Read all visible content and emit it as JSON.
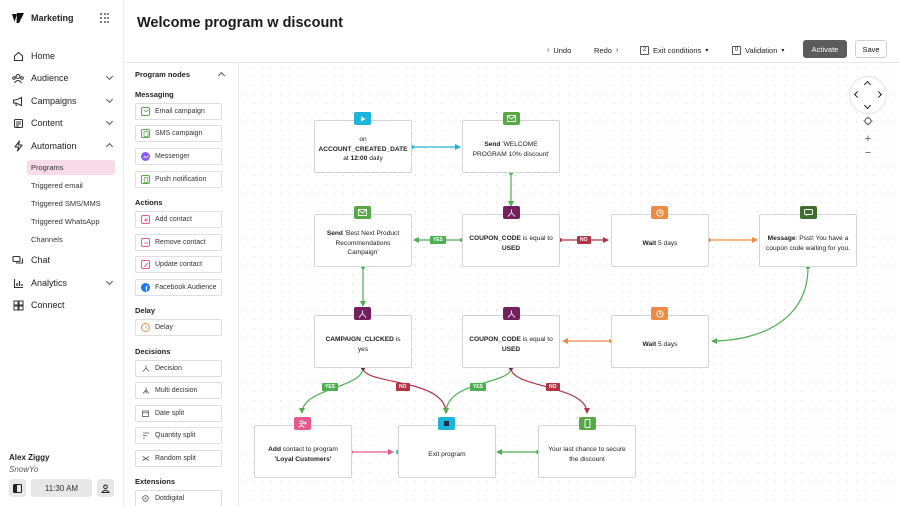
{
  "app": {
    "name": "Marketing"
  },
  "nav": {
    "items": [
      {
        "label": "Home",
        "icon": "home-icon"
      },
      {
        "label": "Audience",
        "icon": "audience-icon"
      },
      {
        "label": "Campaigns",
        "icon": "megaphone-icon"
      },
      {
        "label": "Content",
        "icon": "content-icon"
      },
      {
        "label": "Automation",
        "icon": "automation-icon"
      }
    ],
    "automation_sub": [
      "Programs",
      "Triggered email",
      "Triggered SMS/MMS",
      "Triggered WhatsApp",
      "Channels"
    ],
    "bottom_items": [
      {
        "label": "Chat",
        "icon": "chat-icon"
      },
      {
        "label": "Analytics",
        "icon": "analytics-icon"
      },
      {
        "label": "Connect",
        "icon": "connect-icon"
      }
    ]
  },
  "user": {
    "name": "Alex Ziggy",
    "org": "SnowYo",
    "time": "11:30 AM"
  },
  "page": {
    "title": "Welcome program w discount"
  },
  "toolbar": {
    "undo": "Undo",
    "redo": "Redo",
    "exit_conditions": "Exit conditions",
    "exit_conditions_count": "2",
    "validation": "Validation",
    "validation_count": "0",
    "activate": "Activate",
    "save": "Save"
  },
  "panel": {
    "title": "Program nodes",
    "sections": {
      "messaging": "Messaging",
      "actions": "Actions",
      "delay": "Delay",
      "decisions": "Decisions",
      "extensions": "Extensions"
    },
    "messaging": [
      "Email campaign",
      "SMS campaign",
      "Messenger",
      "Push notification"
    ],
    "actions": [
      "Add contact",
      "Remove contact",
      "Update contact",
      "Facebook Audience"
    ],
    "delay": [
      "Delay"
    ],
    "decisions": [
      "Decision",
      "Multi decision",
      "Date split",
      "Quantity split",
      "Random split"
    ],
    "extensions": [
      "Dotdigital"
    ]
  },
  "flow": {
    "trigger": {
      "on": "on",
      "event": "ACCOUNT_CREATED_DATE",
      "at": "at",
      "time": "12:00",
      "freq": "daily"
    },
    "send_welcome": {
      "verb": "Send",
      "text": "'WELCOME PROGRAM 10% discount'"
    },
    "coupon1": {
      "field": "COUPON_CODE",
      "op": "is equal to",
      "value": "USED"
    },
    "send_best": {
      "verb": "Send",
      "text": "'Best Next Product Recommendations Campaign'"
    },
    "wait1": {
      "value": "Wait",
      "text": "5 days"
    },
    "message": {
      "verb": "Message",
      "text": ": Psst! You have a coupon code waiting for you."
    },
    "campaign_clicked": {
      "field": "CAMPAIGN_CLICKED",
      "op": "is yes"
    },
    "coupon2": {
      "field": "COUPON_CODE",
      "op": "is equal to",
      "value": "USED"
    },
    "wait2": {
      "value": "Wait",
      "text": "5 days"
    },
    "add_contact": {
      "verb": "Add",
      "text": "contact to program",
      "program": "'Loyal Customers'"
    },
    "exit": {
      "text": "Exit program"
    },
    "last_chance": {
      "text": "Your last chance to secure the discount"
    },
    "labels": {
      "yes": "YES",
      "no": "NO"
    }
  },
  "colors": {
    "email": "#5aa845",
    "decision": "#74205f",
    "wait": "#ee8b43",
    "trigger": "#1cb4d8",
    "exit": "#1cb4d8",
    "add": "#e8598d",
    "sms": "#5aa845",
    "nav_active": "#f7dbe6"
  }
}
